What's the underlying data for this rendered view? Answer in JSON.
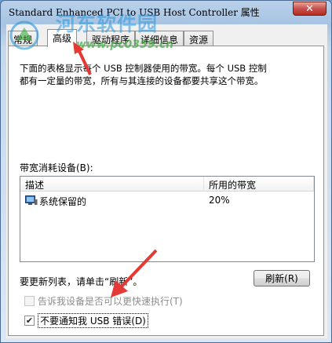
{
  "window": {
    "title": "Standard Enhanced PCI to USB Host Controller 属性",
    "close_label": "✕"
  },
  "tabs": [
    {
      "label": "常规"
    },
    {
      "label": "高级"
    },
    {
      "label": "驱动程序"
    },
    {
      "label": "详细信息"
    },
    {
      "label": "资源"
    }
  ],
  "panel": {
    "description_line1": "下面的表格显示每个 USB 控制器使用的带宽。每个 USB 控制",
    "description_line2": "都有一定量的带宽，所有与其连接的设备都要共享这个带宽。",
    "section_label": "带宽消耗设备(B):",
    "columns": [
      "描述",
      "所用的带宽"
    ],
    "rows": [
      {
        "description": "系统保留的",
        "bandwidth": "20%"
      }
    ],
    "refresh_hint": "要更新列表，请单击“刷新”。",
    "refresh_button": "刷新(R)",
    "checkbox_notify_fast": {
      "label": "告诉我设备是否可以更快速执行(T)",
      "checked": false,
      "enabled": false
    },
    "checkbox_no_usb_errors": {
      "label": "不要通知我 USB 错误(D)",
      "checked": true,
      "enabled": true
    }
  },
  "watermark": {
    "site_name": "河东软件园",
    "url": "www.pc0359.cn"
  },
  "colors": {
    "accent_arrow": "#e53935",
    "watermark_blue": "#2896dc",
    "watermark_green": "#3caa3c"
  }
}
